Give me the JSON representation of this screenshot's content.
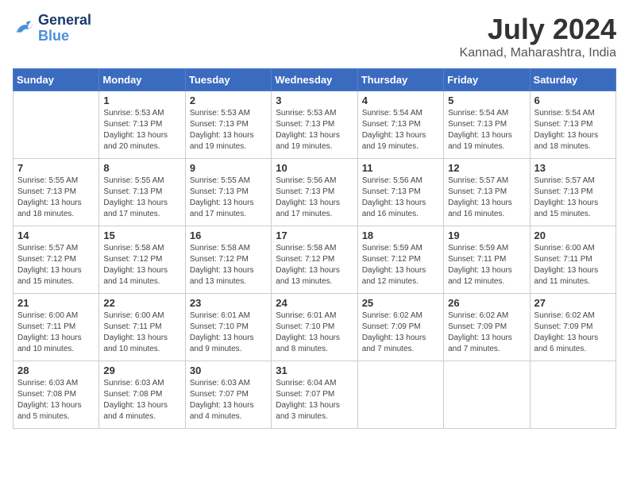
{
  "header": {
    "logo_line1": "General",
    "logo_line2": "Blue",
    "month": "July 2024",
    "location": "Kannad, Maharashtra, India"
  },
  "days_of_week": [
    "Sunday",
    "Monday",
    "Tuesday",
    "Wednesday",
    "Thursday",
    "Friday",
    "Saturday"
  ],
  "weeks": [
    [
      {
        "day": "",
        "info": ""
      },
      {
        "day": "1",
        "info": "Sunrise: 5:53 AM\nSunset: 7:13 PM\nDaylight: 13 hours\nand 20 minutes."
      },
      {
        "day": "2",
        "info": "Sunrise: 5:53 AM\nSunset: 7:13 PM\nDaylight: 13 hours\nand 19 minutes."
      },
      {
        "day": "3",
        "info": "Sunrise: 5:53 AM\nSunset: 7:13 PM\nDaylight: 13 hours\nand 19 minutes."
      },
      {
        "day": "4",
        "info": "Sunrise: 5:54 AM\nSunset: 7:13 PM\nDaylight: 13 hours\nand 19 minutes."
      },
      {
        "day": "5",
        "info": "Sunrise: 5:54 AM\nSunset: 7:13 PM\nDaylight: 13 hours\nand 19 minutes."
      },
      {
        "day": "6",
        "info": "Sunrise: 5:54 AM\nSunset: 7:13 PM\nDaylight: 13 hours\nand 18 minutes."
      }
    ],
    [
      {
        "day": "7",
        "info": "Sunrise: 5:55 AM\nSunset: 7:13 PM\nDaylight: 13 hours\nand 18 minutes."
      },
      {
        "day": "8",
        "info": "Sunrise: 5:55 AM\nSunset: 7:13 PM\nDaylight: 13 hours\nand 17 minutes."
      },
      {
        "day": "9",
        "info": "Sunrise: 5:55 AM\nSunset: 7:13 PM\nDaylight: 13 hours\nand 17 minutes."
      },
      {
        "day": "10",
        "info": "Sunrise: 5:56 AM\nSunset: 7:13 PM\nDaylight: 13 hours\nand 17 minutes."
      },
      {
        "day": "11",
        "info": "Sunrise: 5:56 AM\nSunset: 7:13 PM\nDaylight: 13 hours\nand 16 minutes."
      },
      {
        "day": "12",
        "info": "Sunrise: 5:57 AM\nSunset: 7:13 PM\nDaylight: 13 hours\nand 16 minutes."
      },
      {
        "day": "13",
        "info": "Sunrise: 5:57 AM\nSunset: 7:13 PM\nDaylight: 13 hours\nand 15 minutes."
      }
    ],
    [
      {
        "day": "14",
        "info": "Sunrise: 5:57 AM\nSunset: 7:12 PM\nDaylight: 13 hours\nand 15 minutes."
      },
      {
        "day": "15",
        "info": "Sunrise: 5:58 AM\nSunset: 7:12 PM\nDaylight: 13 hours\nand 14 minutes."
      },
      {
        "day": "16",
        "info": "Sunrise: 5:58 AM\nSunset: 7:12 PM\nDaylight: 13 hours\nand 13 minutes."
      },
      {
        "day": "17",
        "info": "Sunrise: 5:58 AM\nSunset: 7:12 PM\nDaylight: 13 hours\nand 13 minutes."
      },
      {
        "day": "18",
        "info": "Sunrise: 5:59 AM\nSunset: 7:12 PM\nDaylight: 13 hours\nand 12 minutes."
      },
      {
        "day": "19",
        "info": "Sunrise: 5:59 AM\nSunset: 7:11 PM\nDaylight: 13 hours\nand 12 minutes."
      },
      {
        "day": "20",
        "info": "Sunrise: 6:00 AM\nSunset: 7:11 PM\nDaylight: 13 hours\nand 11 minutes."
      }
    ],
    [
      {
        "day": "21",
        "info": "Sunrise: 6:00 AM\nSunset: 7:11 PM\nDaylight: 13 hours\nand 10 minutes."
      },
      {
        "day": "22",
        "info": "Sunrise: 6:00 AM\nSunset: 7:11 PM\nDaylight: 13 hours\nand 10 minutes."
      },
      {
        "day": "23",
        "info": "Sunrise: 6:01 AM\nSunset: 7:10 PM\nDaylight: 13 hours\nand 9 minutes."
      },
      {
        "day": "24",
        "info": "Sunrise: 6:01 AM\nSunset: 7:10 PM\nDaylight: 13 hours\nand 8 minutes."
      },
      {
        "day": "25",
        "info": "Sunrise: 6:02 AM\nSunset: 7:09 PM\nDaylight: 13 hours\nand 7 minutes."
      },
      {
        "day": "26",
        "info": "Sunrise: 6:02 AM\nSunset: 7:09 PM\nDaylight: 13 hours\nand 7 minutes."
      },
      {
        "day": "27",
        "info": "Sunrise: 6:02 AM\nSunset: 7:09 PM\nDaylight: 13 hours\nand 6 minutes."
      }
    ],
    [
      {
        "day": "28",
        "info": "Sunrise: 6:03 AM\nSunset: 7:08 PM\nDaylight: 13 hours\nand 5 minutes."
      },
      {
        "day": "29",
        "info": "Sunrise: 6:03 AM\nSunset: 7:08 PM\nDaylight: 13 hours\nand 4 minutes."
      },
      {
        "day": "30",
        "info": "Sunrise: 6:03 AM\nSunset: 7:07 PM\nDaylight: 13 hours\nand 4 minutes."
      },
      {
        "day": "31",
        "info": "Sunrise: 6:04 AM\nSunset: 7:07 PM\nDaylight: 13 hours\nand 3 minutes."
      },
      {
        "day": "",
        "info": ""
      },
      {
        "day": "",
        "info": ""
      },
      {
        "day": "",
        "info": ""
      }
    ]
  ]
}
